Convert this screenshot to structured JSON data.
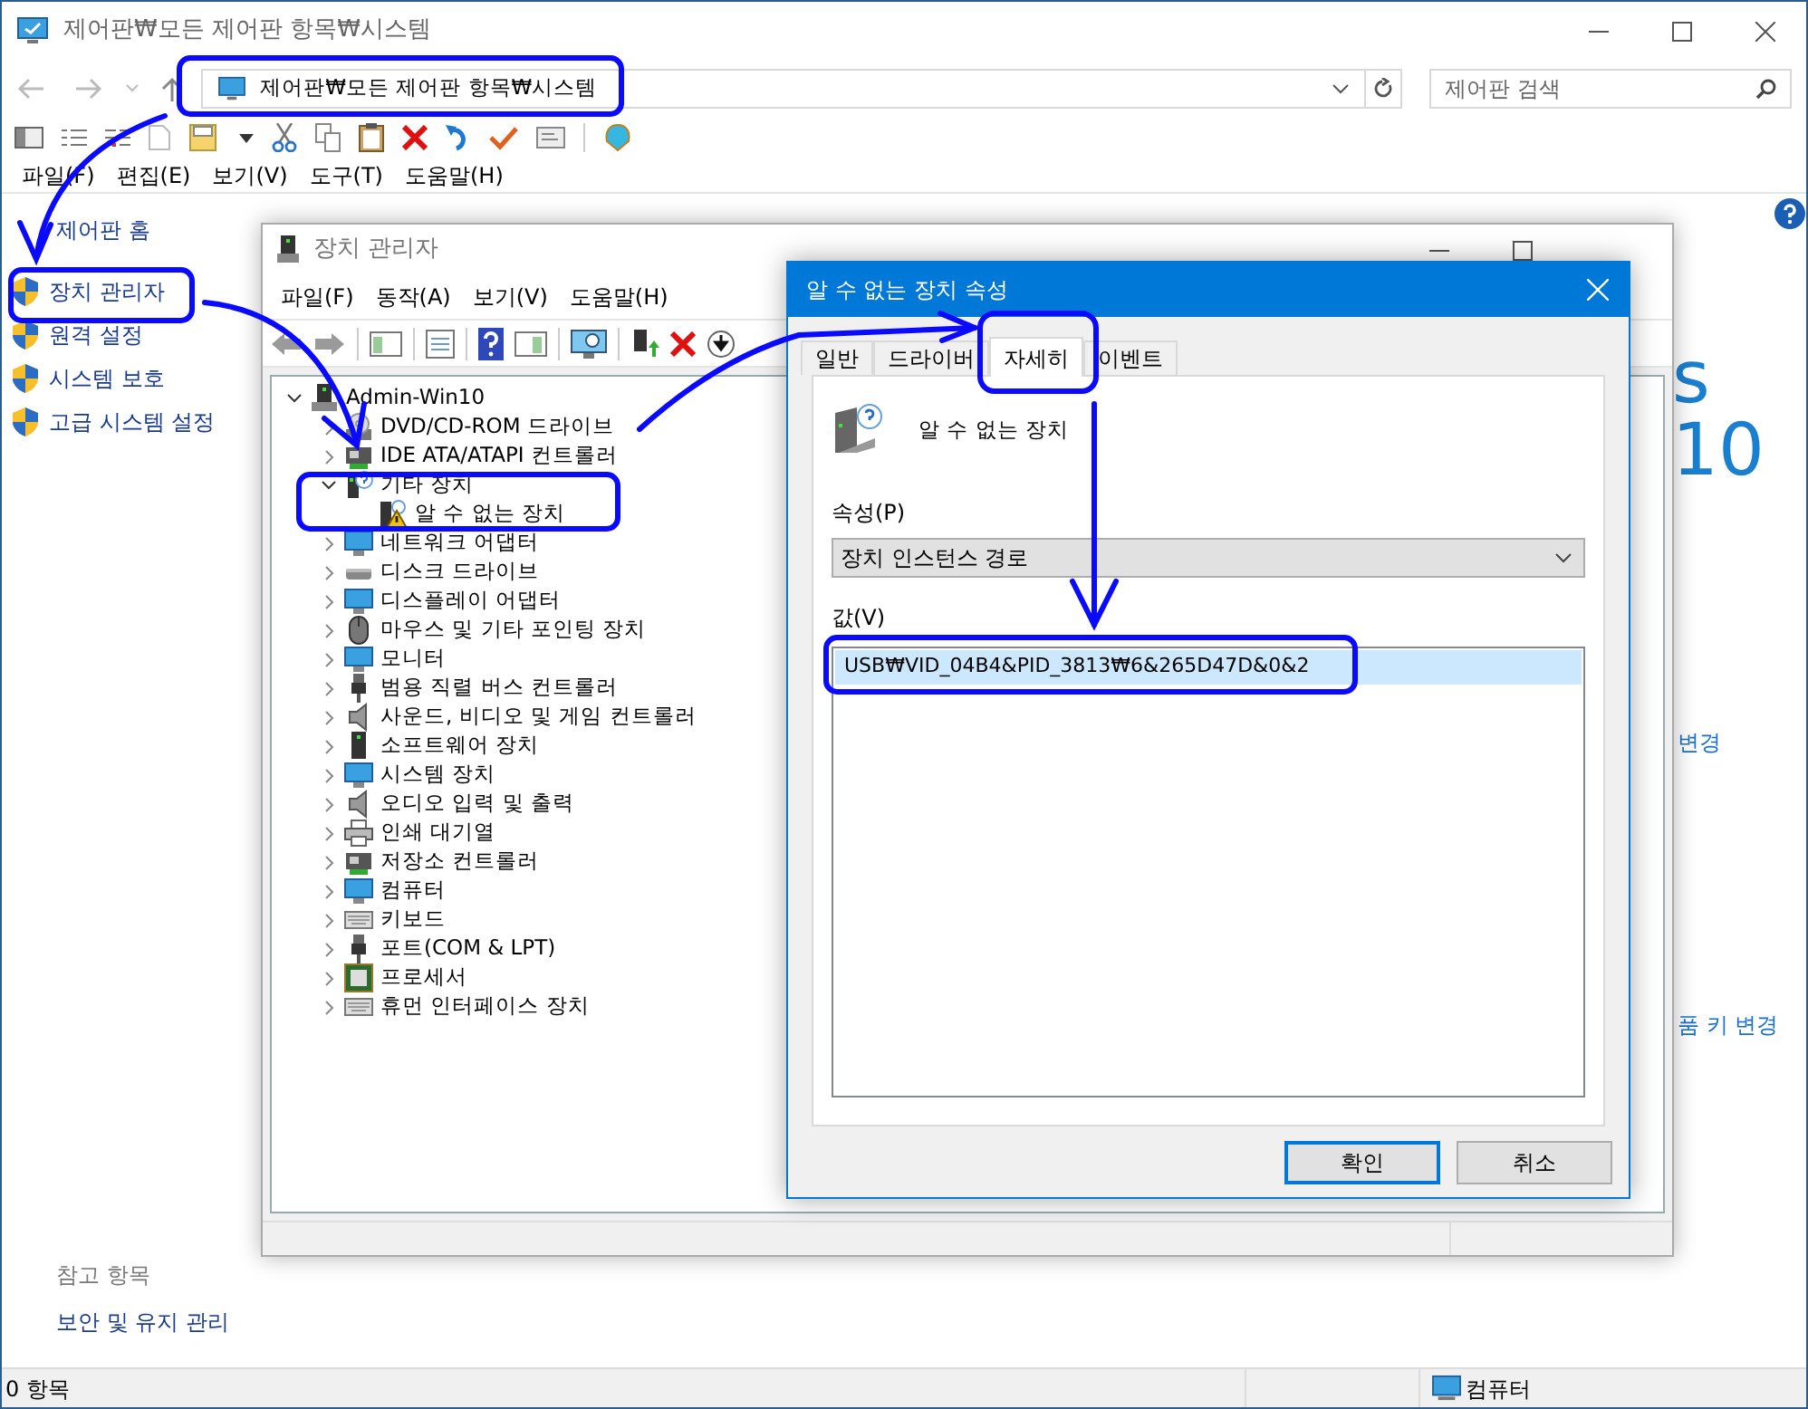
{
  "window": {
    "title": "제어판₩모든 제어판 항목₩시스템",
    "address": "제어판₩모든 제어판 항목₩시스템",
    "search_placeholder": "제어판 검색",
    "menu": [
      "파일(F)",
      "편집(E)",
      "보기(V)",
      "도구(T)",
      "도움말(H)"
    ]
  },
  "sidebar": {
    "home": "제어판 홈",
    "links": [
      "장치 관리자",
      "원격 설정",
      "시스템 보호",
      "고급 시스템 설정"
    ],
    "see_also_title": "참고 항목",
    "see_also": [
      "보안 및 유지 관리"
    ]
  },
  "background_panel": {
    "logo_text": "s 10",
    "links": [
      "변경",
      "품 키 변경"
    ]
  },
  "status_bar": {
    "items": "0 항목",
    "location": "컴퓨터"
  },
  "device_manager": {
    "title": "장치 관리자",
    "menu": [
      "파일(F)",
      "동작(A)",
      "보기(V)",
      "도움말(H)"
    ],
    "tree": {
      "label": "Admin-Win10",
      "kind": "computer",
      "expanded": true,
      "children": [
        {
          "label": "DVD/CD-ROM 드라이브",
          "kind": "disc",
          "expanded": false
        },
        {
          "label": "IDE ATA/ATAPI 컨트롤러",
          "kind": "card",
          "expanded": false
        },
        {
          "label": "기타 장치",
          "kind": "unknown",
          "expanded": true,
          "children": [
            {
              "label": "알 수 없는 장치",
              "kind": "warning"
            }
          ]
        },
        {
          "label": "네트워크 어댑터",
          "kind": "monitor",
          "expanded": false
        },
        {
          "label": "디스크 드라이브",
          "kind": "drive",
          "expanded": false
        },
        {
          "label": "디스플레이 어댑터",
          "kind": "monitor",
          "expanded": false
        },
        {
          "label": "마우스 및 기타 포인팅 장치",
          "kind": "mouse",
          "expanded": false
        },
        {
          "label": "모니터",
          "kind": "monitor",
          "expanded": false
        },
        {
          "label": "범용 직렬 버스 컨트롤러",
          "kind": "plug",
          "expanded": false
        },
        {
          "label": "사운드, 비디오 및 게임 컨트롤러",
          "kind": "speaker",
          "expanded": false
        },
        {
          "label": "소프트웨어 장치",
          "kind": "tower",
          "expanded": false
        },
        {
          "label": "시스템 장치",
          "kind": "monitor",
          "expanded": false
        },
        {
          "label": "오디오 입력 및 출력",
          "kind": "speaker",
          "expanded": false
        },
        {
          "label": "인쇄 대기열",
          "kind": "printer",
          "expanded": false
        },
        {
          "label": "저장소 컨트롤러",
          "kind": "card",
          "expanded": false
        },
        {
          "label": "컴퓨터",
          "kind": "monitor",
          "expanded": false
        },
        {
          "label": "키보드",
          "kind": "keyboard",
          "expanded": false
        },
        {
          "label": "포트(COM & LPT)",
          "kind": "plug",
          "expanded": false
        },
        {
          "label": "프로세서",
          "kind": "chip",
          "expanded": false
        },
        {
          "label": "휴먼 인터페이스 장치",
          "kind": "keyboard",
          "expanded": false
        }
      ]
    }
  },
  "properties_dialog": {
    "title": "알 수 없는 장치 속성",
    "tabs": [
      {
        "label": "일반",
        "selected": false
      },
      {
        "label": "드라이버",
        "selected": false
      },
      {
        "label": "자세히",
        "selected": true
      },
      {
        "label": "이벤트",
        "selected": false
      }
    ],
    "device_name": "알 수 없는 장치",
    "property_label": "속성(P)",
    "property_value": "장치 인스턴스 경로",
    "value_label": "값(V)",
    "values": [
      {
        "text": "USB₩VID_04B4&PID_3813₩6&265D47D&0&2",
        "selected": true
      }
    ],
    "buttons": [
      {
        "label": "확인",
        "default": true
      },
      {
        "label": "취소",
        "default": false
      }
    ]
  }
}
